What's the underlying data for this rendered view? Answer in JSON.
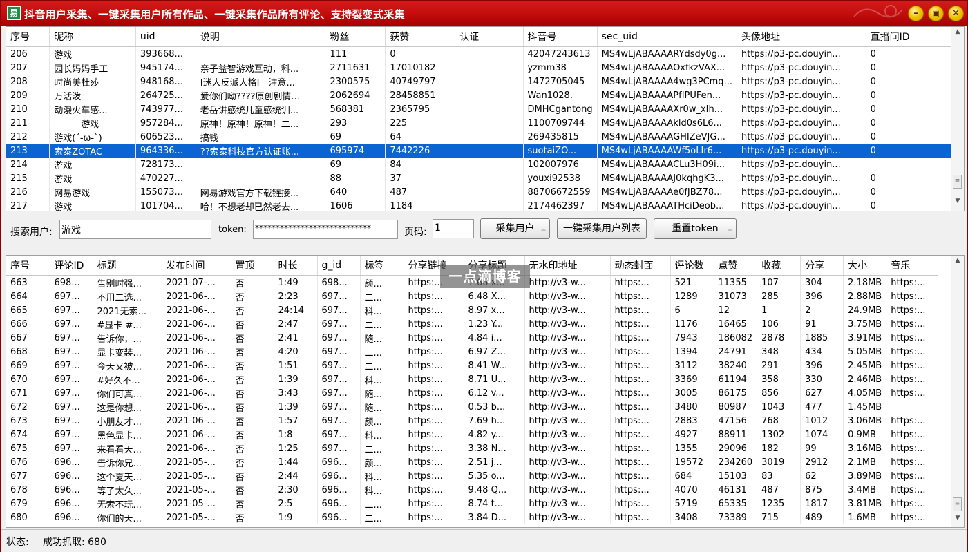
{
  "window": {
    "title": "抖音用户采集、一键采集用户所有作品、一键采集作品所有评论、支持裂变式采集"
  },
  "users_table": {
    "columns": [
      "序号",
      "昵称",
      "uid",
      "说明",
      "粉丝",
      "获赞",
      "认证",
      "抖音号",
      "sec_uid",
      "头像地址",
      "直播间ID"
    ],
    "selected_index": 7,
    "rows": [
      [
        "206",
        "游戏",
        "393668...",
        "",
        "111",
        "0",
        "",
        "42047243613",
        "MS4wLjABAAAARYdsdy0g...",
        "https://p3-pc.douyin...",
        "0"
      ],
      [
        "207",
        "园长妈妈手工",
        "945174...",
        "亲子益智游戏互动，科...",
        "2711631",
        "17010182",
        "",
        "yzmm38",
        "MS4wLjABAAAAOxfkzVAX...",
        "https://p3-pc.douyin...",
        "0"
      ],
      [
        "208",
        "时尚美杜莎",
        "948168...",
        "I迷人反派人格I　注意...",
        "2300575",
        "40749797",
        "",
        "1472705045",
        "MS4wLjABAAAA4wg3PCmq...",
        "https://p3-pc.douyin...",
        "0"
      ],
      [
        "209",
        "万活泼",
        "264725...",
        "爱你们呦????原创剧情...",
        "2062694",
        "28458851",
        "",
        "Wan1028.",
        "MS4wLjABAAAAPfIPUFen...",
        "https://p3-pc.douyin...",
        "0"
      ],
      [
        "210",
        "动漫火车感...",
        "743977...",
        "老岳讲感统儿童感统训...",
        "568381",
        "2365795",
        "",
        "DMHCgantong",
        "MS4wLjABAAAAXr0w_xIh...",
        "https://p3-pc.douyin...",
        "0"
      ],
      [
        "211",
        "______游戏",
        "957284...",
        "原神！原神！原神！二...",
        "293",
        "225",
        "",
        "1100709744",
        "MS4wLjABAAAAkld0s6L6...",
        "https://p3-pc.douyin...",
        "0"
      ],
      [
        "212",
        "游戏(´-ω-`)",
        "606523...",
        "搞钱",
        "69",
        "64",
        "",
        "269435815",
        "MS4wLjABAAAAGHIZeVJG...",
        "https://p3-pc.douyin...",
        "0"
      ],
      [
        "213",
        "索泰ZOTAC",
        "964336...",
        "??索泰科技官方认证账...",
        "695974",
        "7442226",
        "",
        "suotaiZO...",
        "MS4wLjABAAAAWf5oLIr6...",
        "https://p3-pc.douyin...",
        "0"
      ],
      [
        "214",
        "游戏",
        "728173...",
        "",
        "69",
        "84",
        "",
        "102007976",
        "MS4wLjABAAAACLu3H09i...",
        "https://p3-pc.douyin...",
        ""
      ],
      [
        "215",
        "游戏",
        "470227...",
        "",
        "88",
        "37",
        "",
        "youxi92538",
        "MS4wLjABAAAAJ0kqhgK3...",
        "https://p3-pc.douyin...",
        "0"
      ],
      [
        "216",
        "网易游戏",
        "155073...",
        "网易游戏官方下载链接...",
        "640",
        "487",
        "",
        "88706672559",
        "MS4wLjABAAAAe0fJBZ78...",
        "https://p3-pc.douyin...",
        "0"
      ],
      [
        "217",
        "游戏",
        "101704...",
        "哈！不想老却已然老去...",
        "1606",
        "1184",
        "",
        "2174462397",
        "MS4wLjABAAAATHciDeob...",
        "https://p3-pc.douyin...",
        "0"
      ]
    ]
  },
  "search": {
    "user_label": "搜索用户:",
    "user_value": "游戏",
    "token_label": "token:",
    "token_value": "****************************",
    "page_label": "页码:",
    "page_value": "1",
    "btn_collect": "采集用户",
    "btn_collect_all": "一键采集用户列表",
    "btn_reset": "重置token"
  },
  "works_table": {
    "columns": [
      "序号",
      "评论ID",
      "标题",
      "发布时间",
      "置顶",
      "时长",
      "g_id",
      "标签",
      "分享链接",
      "分享标题",
      "无水印地址",
      "动态封面",
      "评论数",
      "点赞",
      "收藏",
      "分享",
      "大小",
      "音乐"
    ],
    "rows": [
      [
        "663",
        "698...",
        "告别时强...",
        "2021-07-...",
        "否",
        "1:49",
        "698...",
        "颜...",
        "https:...",
        "7.66 x...",
        "http://v3-w...",
        "https:...",
        "521",
        "11355",
        "107",
        "304",
        "2.18MB",
        "https:..."
      ],
      [
        "664",
        "697...",
        "不用二选...",
        "2021-06-...",
        "否",
        "2:23",
        "697...",
        "二...",
        "https:...",
        "6.48 X...",
        "http://v3-w...",
        "https:...",
        "1289",
        "31073",
        "285",
        "396",
        "2.88MB",
        "https:..."
      ],
      [
        "665",
        "697...",
        "2021无索...",
        "2021-06-...",
        "否",
        "24:14",
        "697...",
        "科...",
        "https:...",
        "8.97 x...",
        "http://v3-w...",
        "https:...",
        "6",
        "12",
        "1",
        "2",
        "24.9MB",
        "https:..."
      ],
      [
        "666",
        "697...",
        "#显卡 #...",
        "2021-06-...",
        "否",
        "2:47",
        "697...",
        "二...",
        "https:...",
        "1.23 Y...",
        "http://v3-w...",
        "https:...",
        "1176",
        "16465",
        "106",
        "91",
        "3.75MB",
        "https:..."
      ],
      [
        "667",
        "697...",
        "告诉你，...",
        "2021-06-...",
        "否",
        "2:41",
        "697...",
        "随...",
        "https:...",
        "4.84 i...",
        "http://v3-w...",
        "https:...",
        "7943",
        "186082",
        "2878",
        "1885",
        "3.91MB",
        "https:..."
      ],
      [
        "668",
        "697...",
        "显卡变装...",
        "2021-06-...",
        "否",
        "4:20",
        "697...",
        "二...",
        "https:...",
        "6.97 Z...",
        "http://v3-w...",
        "https:...",
        "1394",
        "24791",
        "348",
        "434",
        "5.05MB",
        "https:..."
      ],
      [
        "669",
        "697...",
        "今天又被...",
        "2021-06-...",
        "否",
        "1:51",
        "697...",
        "二...",
        "https:...",
        "8.41 W...",
        "http://v3-w...",
        "https:...",
        "3112",
        "38240",
        "291",
        "396",
        "2.45MB",
        "https:..."
      ],
      [
        "670",
        "697...",
        "#好久不...",
        "2021-06-...",
        "否",
        "1:39",
        "697...",
        "科...",
        "https:...",
        "8.71 U...",
        "http://v3-w...",
        "https:...",
        "3369",
        "61194",
        "358",
        "330",
        "2.46MB",
        "https:..."
      ],
      [
        "671",
        "697...",
        "你们可真...",
        "2021-06-...",
        "否",
        "3:43",
        "697...",
        "随...",
        "https:...",
        "6.12 v...",
        "http://v3-w...",
        "https:...",
        "3005",
        "86175",
        "856",
        "627",
        "4.05MB",
        "https:..."
      ],
      [
        "672",
        "697...",
        "这是你想...",
        "2021-06-...",
        "否",
        "1:39",
        "697...",
        "随...",
        "https:...",
        "0.53 b...",
        "http://v3-w...",
        "https:...",
        "3480",
        "80987",
        "1043",
        "477",
        "1.45MB",
        ""
      ],
      [
        "673",
        "697...",
        "小朋友才...",
        "2021-06-...",
        "否",
        "1:57",
        "697...",
        "颜...",
        "https:...",
        "7.69 h...",
        "http://v3-w...",
        "https:...",
        "2883",
        "47156",
        "768",
        "1012",
        "3.06MB",
        "https:..."
      ],
      [
        "674",
        "697...",
        "黑色显卡...",
        "2021-06-...",
        "否",
        "1:8",
        "697...",
        "科...",
        "https:...",
        "4.82 y...",
        "http://v3-w...",
        "https:...",
        "4927",
        "88911",
        "1302",
        "1074",
        "0.9MB",
        "https:..."
      ],
      [
        "675",
        "697...",
        "来看看天...",
        "2021-06-...",
        "否",
        "1:25",
        "697...",
        "二...",
        "https:...",
        "3.38 N...",
        "http://v3-w...",
        "https:...",
        "1355",
        "29096",
        "182",
        "99",
        "3.16MB",
        "https:..."
      ],
      [
        "676",
        "696...",
        "告诉你兄...",
        "2021-05-...",
        "否",
        "1:44",
        "696...",
        "颜...",
        "https:...",
        "2.51 j...",
        "http://v3-w...",
        "https:...",
        "19572",
        "234260",
        "3019",
        "2912",
        "2.1MB",
        "https:..."
      ],
      [
        "677",
        "696...",
        "这个夏天...",
        "2021-05-...",
        "否",
        "2:44",
        "696...",
        "科...",
        "https:...",
        "5.35 o...",
        "http://v3-w...",
        "https:...",
        "684",
        "15103",
        "83",
        "62",
        "3.89MB",
        "https:..."
      ],
      [
        "678",
        "696...",
        "等了太久...",
        "2021-05-...",
        "否",
        "2:30",
        "696...",
        "科...",
        "https:...",
        "9.48 Q...",
        "http://v3-w...",
        "https:...",
        "4070",
        "46131",
        "487",
        "875",
        "3.4MB",
        "https:..."
      ],
      [
        "679",
        "696...",
        "无索不玩...",
        "2021-05-...",
        "否",
        "2:5",
        "696...",
        "二...",
        "https:...",
        "8.74 t...",
        "http://v3-w...",
        "https:...",
        "5719",
        "65335",
        "1235",
        "1817",
        "3.81MB",
        "https:..."
      ],
      [
        "680",
        "696...",
        "你们的天...",
        "2021-05-...",
        "否",
        "1:9",
        "696...",
        "二...",
        "https:...",
        "3.84 D...",
        "http://v3-w...",
        "https:...",
        "3408",
        "73389",
        "715",
        "489",
        "1.6MB",
        "https:..."
      ]
    ]
  },
  "watermark": "一点滴博客",
  "status": {
    "label": "状态:",
    "text": "成功抓取: 680"
  },
  "colors": {
    "titlebar": "#c40e0e",
    "selection": "#0a64d2",
    "window_button": "#f4c300"
  }
}
